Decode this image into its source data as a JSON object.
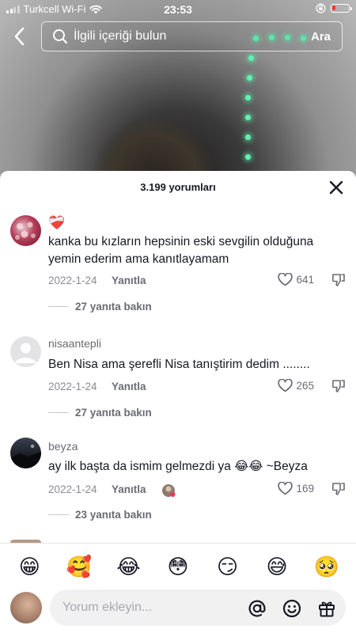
{
  "status_bar": {
    "carrier": "Turkcell Wi-Fi",
    "time": "23:53"
  },
  "search": {
    "placeholder": "İlgili içeriği bulun",
    "button_label": "Ara"
  },
  "comments_panel": {
    "title": "3.199 yorumları",
    "comments": [
      {
        "username": "",
        "badge_emoji": "❤️‍🩹",
        "text": "kanka bu kızların hepsinin eski sevgilin olduğuna yemin ederim ama kanıtlayamam",
        "date": "2022-1-24",
        "reply_label": "Yanıtla",
        "likes": "641",
        "view_replies": "27 yanıta bakın"
      },
      {
        "username": "nisaantepli",
        "text": "Ben Nisa ama şerefli Nisa tanıştirim dedim ........",
        "date": "2022-1-24",
        "reply_label": "Yanıtla",
        "likes": "265",
        "view_replies": "27 yanıta bakın"
      },
      {
        "username": "beyza",
        "text": "ay ilk başta da ismim gelmezdi ya 😂😂 ~Beyza",
        "date": "2022-1-24",
        "reply_label": "Yanıtla",
        "likes": "169",
        "view_replies": "23 yanıta bakın"
      }
    ]
  },
  "emoji_bar": [
    "😁",
    "🥰",
    "😂",
    "😳",
    "😏",
    "😅",
    "🥺"
  ],
  "input": {
    "placeholder": "Yorum ekleyin..."
  },
  "icons": {
    "back": "chevron-left-icon",
    "search": "search-icon",
    "close": "close-icon",
    "like": "heart-icon",
    "dislike": "thumbs-down-icon",
    "mention": "at-icon",
    "emoji": "smiley-icon",
    "gift": "gift-icon"
  },
  "colors": {
    "accent_led": "#5ff2b0",
    "text_primary": "#161823",
    "text_secondary": "#8a8b91",
    "battery_low": "#ff3b30"
  }
}
